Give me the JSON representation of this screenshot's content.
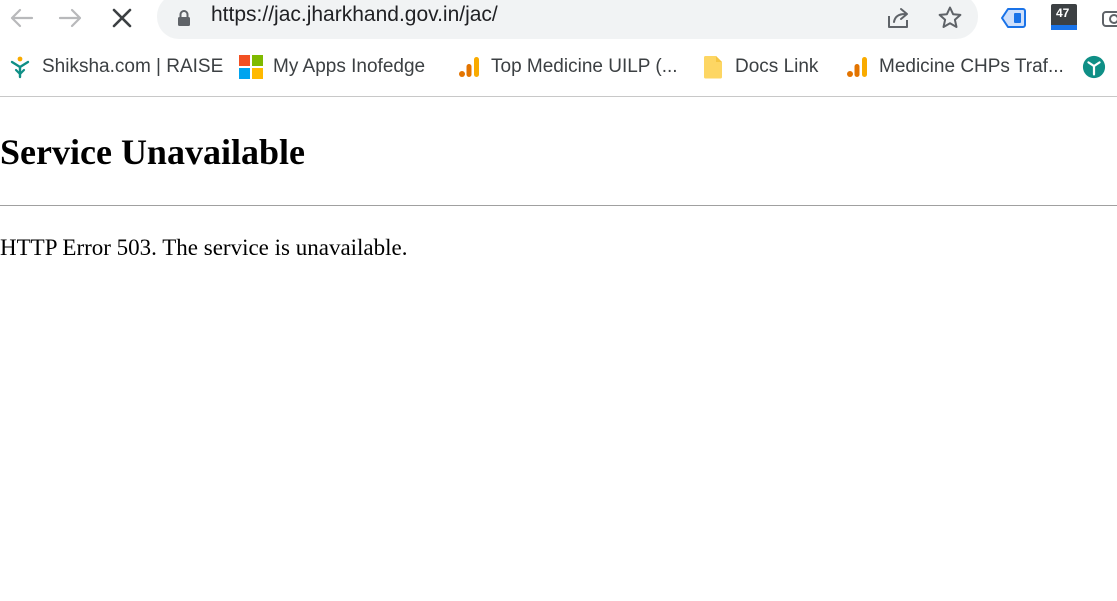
{
  "browser": {
    "url": "https://jac.jharkhand.gov.in/jac/",
    "loading": true,
    "extension_badge": "47"
  },
  "bookmarks": [
    {
      "label": "Shiksha.com | RAISE",
      "icon": "shiksha-icon"
    },
    {
      "label": "My Apps Inofedge",
      "icon": "microsoft-icon"
    },
    {
      "label": "Top Medicine UILP (...",
      "icon": "analytics-icon"
    },
    {
      "label": "Docs Link",
      "icon": "folder-icon"
    },
    {
      "label": "Medicine CHPs Traf...",
      "icon": "analytics-icon"
    },
    {
      "label": "",
      "icon": "globe-icon"
    }
  ],
  "page": {
    "title": "Service Unavailable",
    "message": "HTTP Error 503. The service is unavailable."
  },
  "colors": {
    "omnibox_bg": "#f1f3f4",
    "analytics_orange": "#f9ab00",
    "analytics_dark_orange": "#e37400",
    "shiksha_teal": "#0f8f86",
    "extension_blue": "#1a73e8"
  }
}
